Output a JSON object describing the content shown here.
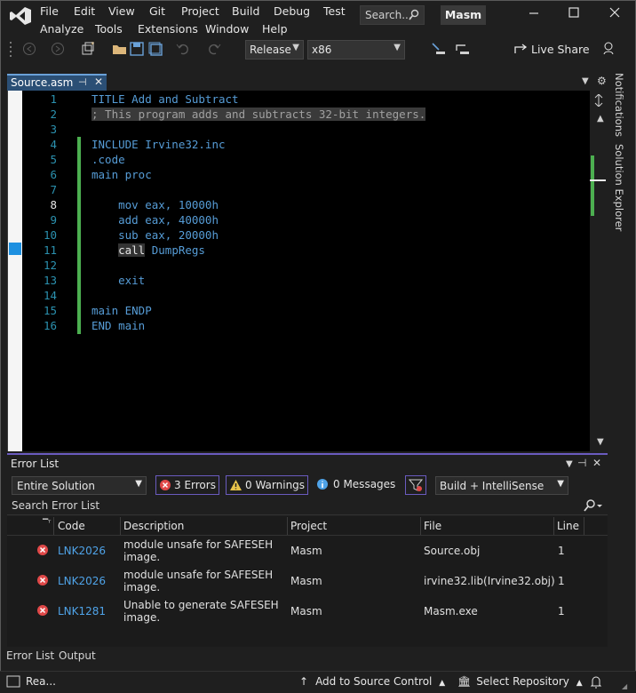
{
  "menu": {
    "row1": [
      "File",
      "Edit",
      "View",
      "Git",
      "Project",
      "Build",
      "Debug",
      "Test"
    ],
    "row2": [
      "Analyze",
      "Tools",
      "Extensions",
      "Window",
      "Help"
    ]
  },
  "search": {
    "label": "Search..."
  },
  "solution_name": "Masm",
  "toolbar": {
    "configuration": "Release",
    "platform": "x86",
    "live_share": "Live Share"
  },
  "tab": {
    "title": "Source.asm"
  },
  "editor": {
    "line_numbers": [
      "1",
      "2",
      "3",
      "4",
      "5",
      "6",
      "7",
      "8",
      "9",
      "10",
      "11",
      "12",
      "13",
      "14",
      "15",
      "16"
    ],
    "lines": [
      "TITLE Add and Subtract",
      "; This program adds and subtracts 32-bit integers.",
      "",
      "INCLUDE Irvine32.inc",
      ".code",
      "main proc",
      "",
      "    mov eax, 10000h",
      "    add eax, 40000h",
      "    sub eax, 20000h",
      "    call DumpRegs",
      "",
      "    exit",
      "",
      "main ENDP",
      "END main"
    ]
  },
  "side_panels": {
    "notifications": "Notifications",
    "solution_explorer": "Solution Explorer"
  },
  "error_list": {
    "title": "Error List",
    "scope": "Entire Solution",
    "errors_label": "3 Errors",
    "warnings_label": "0 Warnings",
    "messages_label": "0 Messages",
    "build_filter": "Build + IntelliSense",
    "search_placeholder": "Search Error List",
    "columns": {
      "code": "Code",
      "description": "Description",
      "project": "Project",
      "file": "File",
      "line": "Line"
    },
    "rows": [
      {
        "code": "LNK2026",
        "desc1": "module unsafe for SAFESEH",
        "desc2": "image.",
        "project": "Masm",
        "file": "Source.obj",
        "line": "1"
      },
      {
        "code": "LNK2026",
        "desc1": "module unsafe for SAFESEH",
        "desc2": "image.",
        "project": "Masm",
        "file": "irvine32.lib(Irvine32.obj)",
        "line": "1"
      },
      {
        "code": "LNK1281",
        "desc1": "Unable to generate SAFESEH",
        "desc2": "image.",
        "project": "Masm",
        "file": "Masm.exe",
        "line": "1"
      }
    ],
    "colors": {
      "error": "#e04848",
      "accent": "#6a5bbf",
      "code_link": "#4fa3e8"
    }
  },
  "bottom_tabs": {
    "error_list": "Error List",
    "output": "Output"
  },
  "status_bar": {
    "ready": "Rea...",
    "source_control": "Add to Source Control",
    "repository": "Select Repository"
  }
}
